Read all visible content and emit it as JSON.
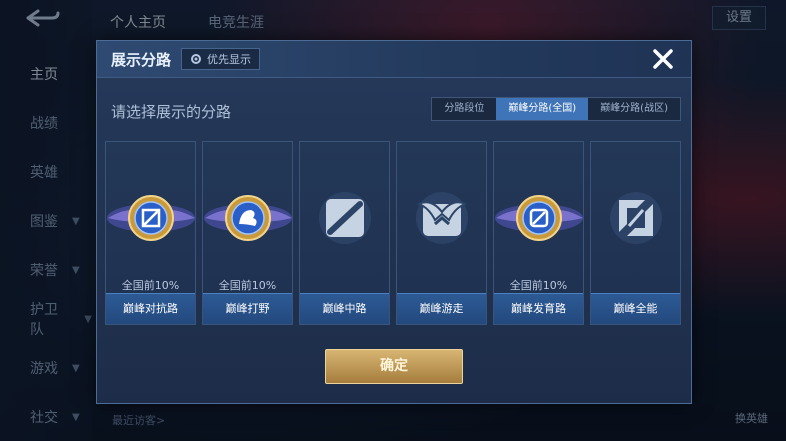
{
  "sidebar": {
    "items": [
      {
        "label": "主页",
        "active": true,
        "chevron": false
      },
      {
        "label": "战绩",
        "active": false,
        "chevron": false
      },
      {
        "label": "英雄",
        "active": false,
        "chevron": false
      },
      {
        "label": "图鉴",
        "active": false,
        "chevron": true
      },
      {
        "label": "荣誉",
        "active": false,
        "chevron": true
      },
      {
        "label": "护卫队",
        "active": false,
        "chevron": true
      },
      {
        "label": "游戏",
        "active": false,
        "chevron": true
      },
      {
        "label": "社交",
        "active": false,
        "chevron": true
      }
    ]
  },
  "top_tabs": [
    "个人主页",
    "电竞生涯"
  ],
  "corner_button": "设置",
  "recent_visitors": "最近访客>",
  "bottom_right": "换英雄",
  "dialog": {
    "title": "展示分路",
    "priority_label": "优先显示",
    "subtitle": "请选择展示的分路",
    "segments": [
      {
        "label": "分路段位",
        "selected": false
      },
      {
        "label": "巅峰分路(全国)",
        "selected": true
      },
      {
        "label": "巅峰分路(战区)",
        "selected": false
      }
    ],
    "cards": [
      {
        "label": "巅峰对抗路",
        "rank": "全国前10%",
        "icon": "clash-lane-emblem-gold"
      },
      {
        "label": "巅峰打野",
        "rank": "全国前10%",
        "icon": "jungle-emblem-gold"
      },
      {
        "label": "巅峰中路",
        "rank": "",
        "icon": "mid-lane-emblem-locked"
      },
      {
        "label": "巅峰游走",
        "rank": "",
        "icon": "roam-emblem-locked"
      },
      {
        "label": "巅峰发育路",
        "rank": "全国前10%",
        "icon": "farm-lane-emblem-gold"
      },
      {
        "label": "巅峰全能",
        "rank": "",
        "icon": "all-round-emblem-locked"
      }
    ],
    "confirm_label": "确定"
  },
  "colors": {
    "accent_blue": "#3f74b8",
    "gold": "#d8b572",
    "panel": "#233757"
  }
}
